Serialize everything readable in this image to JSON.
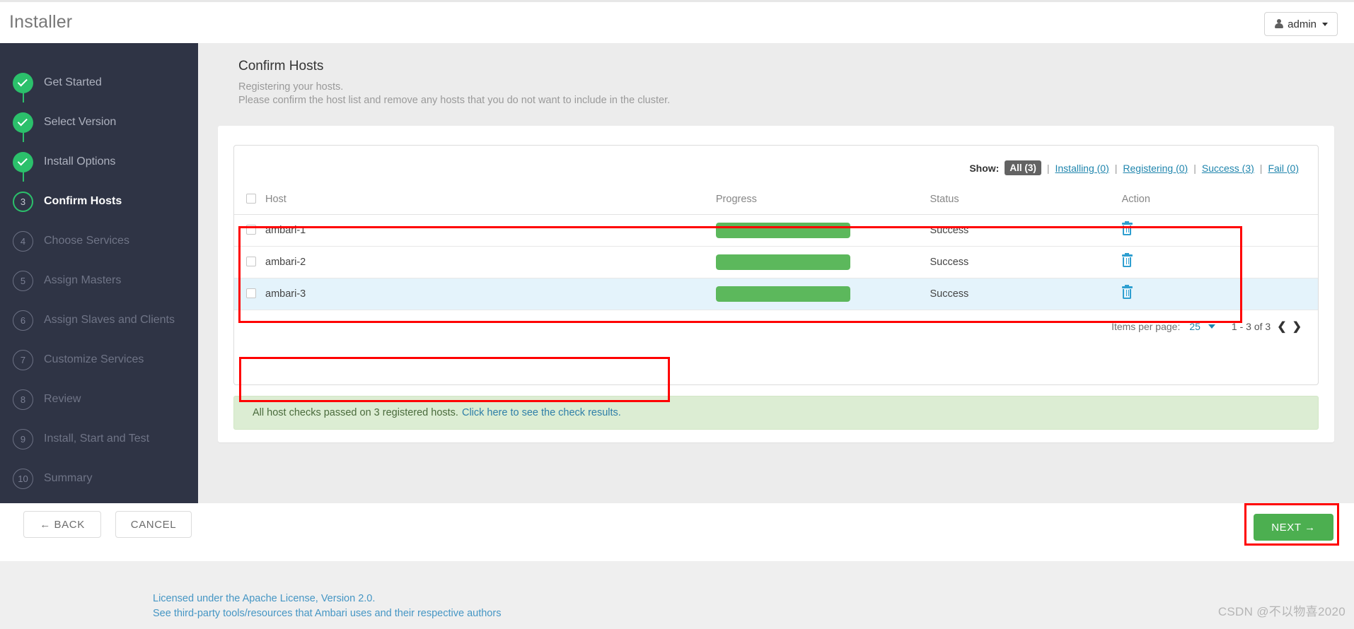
{
  "header": {
    "app_title": "Installer",
    "user_button": "admin",
    "user_icon": "person-icon",
    "caret_icon": "caret-down-icon"
  },
  "sidebar": {
    "steps": [
      {
        "num": "1",
        "label": "Get Started",
        "state": "done"
      },
      {
        "num": "2",
        "label": "Select Version",
        "state": "done"
      },
      {
        "num": "3",
        "label": "Install Options",
        "state": "done"
      },
      {
        "num": "4",
        "label": "Confirm Hosts",
        "state": "current",
        "display_num": "3"
      },
      {
        "num": "5",
        "label": "Choose Services",
        "state": "todo",
        "display_num": "4"
      },
      {
        "num": "6",
        "label": "Assign Masters",
        "state": "todo",
        "display_num": "5"
      },
      {
        "num": "7",
        "label": "Assign Slaves and Clients",
        "state": "todo",
        "display_num": "6"
      },
      {
        "num": "8",
        "label": "Customize Services",
        "state": "todo",
        "display_num": "7"
      },
      {
        "num": "9",
        "label": "Review",
        "state": "todo",
        "display_num": "8"
      },
      {
        "num": "10",
        "label": "Install, Start and Test",
        "state": "todo",
        "display_num": "9"
      },
      {
        "num": "11",
        "label": "Summary",
        "state": "todo",
        "display_num": "10"
      }
    ]
  },
  "main": {
    "page_title": "Confirm Hosts",
    "subtitle_line1": "Registering your hosts.",
    "subtitle_line2": "Please confirm the host list and remove any hosts that you do not want to include in the cluster.",
    "filter": {
      "show_label": "Show:",
      "active": "All (3)",
      "links": [
        "Installing (0)",
        "Registering (0)",
        "Success (3)",
        "Fail (0)"
      ],
      "separator": "|"
    },
    "table": {
      "columns": [
        "Host",
        "Progress",
        "Status",
        "Action"
      ],
      "select_all_icon": "checkbox-icon",
      "rows": [
        {
          "host": "ambari-1",
          "progress": 100,
          "status": "Success",
          "action_icon": "trash-icon",
          "highlighted": false
        },
        {
          "host": "ambari-2",
          "progress": 100,
          "status": "Success",
          "action_icon": "trash-icon",
          "highlighted": false
        },
        {
          "host": "ambari-3",
          "progress": 100,
          "status": "Success",
          "action_icon": "trash-icon",
          "highlighted": true
        }
      ]
    },
    "pager": {
      "items_per_page_label": "Items per page:",
      "items_per_page_value": "25",
      "chevron_icon": "chevron-down-icon",
      "range": "1 - 3 of 3",
      "prev_icon": "chevron-left-icon",
      "next_icon": "chevron-right-icon",
      "prev_glyph": "❮",
      "next_glyph": "❯"
    },
    "alert": {
      "text": "All host checks passed on 3 registered hosts.",
      "link": "Click here to see the check results."
    }
  },
  "buttons": {
    "back": "← BACK",
    "cancel": "CANCEL",
    "next": "NEXT →"
  },
  "footer": {
    "line1": "Licensed under the Apache License, Version 2.0.",
    "line2": "See third-party tools/resources that Ambari uses and their respective authors",
    "watermark": "CSDN @不以物喜2020"
  },
  "colors": {
    "sidebar_bg": "#2f3445",
    "step_done": "#2bc06b",
    "progress_green": "#5cb85c",
    "next_button": "#4caf50",
    "link_blue": "#1f85ad",
    "trash_blue": "#2f9fd0",
    "annotation_red": "#ff0000",
    "row_highlight": "#e4f3fb",
    "alert_bg": "#dcedd3"
  }
}
